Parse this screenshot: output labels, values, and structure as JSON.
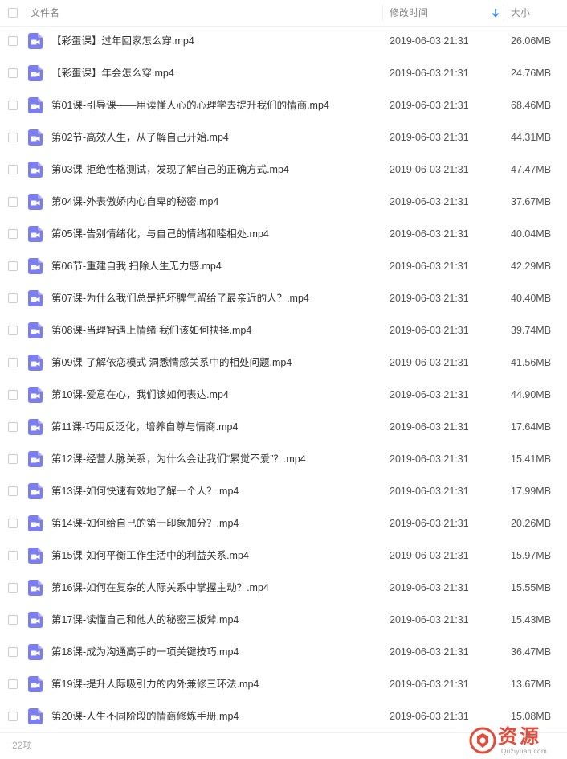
{
  "header": {
    "name_label": "文件名",
    "modified_label": "修改时间",
    "size_label": "大小",
    "sort_arrow": "↓"
  },
  "files": [
    {
      "name": "【彩蛋课】过年回家怎么穿.mp4",
      "modified": "2019-06-03 21:31",
      "size": "26.06MB"
    },
    {
      "name": "【彩蛋课】年会怎么穿.mp4",
      "modified": "2019-06-03 21:31",
      "size": "24.76MB"
    },
    {
      "name": "第01课-引导课——用读懂人心的心理学去提升我们的情商.mp4",
      "modified": "2019-06-03 21:31",
      "size": "68.46MB"
    },
    {
      "name": "第02节-高效人生，从了解自己开始.mp4",
      "modified": "2019-06-03 21:31",
      "size": "44.31MB"
    },
    {
      "name": "第03课-拒绝性格测试，发现了解自己的正确方式.mp4",
      "modified": "2019-06-03 21:31",
      "size": "47.47MB"
    },
    {
      "name": "第04课-外表傲娇内心自卑的秘密.mp4",
      "modified": "2019-06-03 21:31",
      "size": "37.67MB"
    },
    {
      "name": "第05课-告别情绪化，与自己的情绪和睦相处.mp4",
      "modified": "2019-06-03 21:31",
      "size": "40.04MB"
    },
    {
      "name": "第06节-重建自我 扫除人生无力感.mp4",
      "modified": "2019-06-03 21:31",
      "size": "42.29MB"
    },
    {
      "name": "第07课-为什么我们总是把坏脾气留给了最亲近的人？.mp4",
      "modified": "2019-06-03 21:31",
      "size": "40.40MB"
    },
    {
      "name": "第08课-当理智遇上情绪 我们该如何抉择.mp4",
      "modified": "2019-06-03 21:31",
      "size": "39.74MB"
    },
    {
      "name": "第09课-了解依恋模式 洞悉情感关系中的相处问题.mp4",
      "modified": "2019-06-03 21:31",
      "size": "41.56MB"
    },
    {
      "name": "第10课-爱意在心，我们该如何表达.mp4",
      "modified": "2019-06-03 21:31",
      "size": "44.90MB"
    },
    {
      "name": "第11课-巧用反泛化，培养自尊与情商.mp4",
      "modified": "2019-06-03 21:31",
      "size": "17.64MB"
    },
    {
      "name": "第12课-经营人脉关系，为什么会让我们“累觉不爱”？.mp4",
      "modified": "2019-06-03 21:31",
      "size": "15.41MB"
    },
    {
      "name": "第13课-如何快速有效地了解一个人？.mp4",
      "modified": "2019-06-03 21:31",
      "size": "17.99MB"
    },
    {
      "name": "第14课-如何给自己的第一印象加分？.mp4",
      "modified": "2019-06-03 21:31",
      "size": "20.26MB"
    },
    {
      "name": "第15课-如何平衡工作生活中的利益关系.mp4",
      "modified": "2019-06-03 21:31",
      "size": "15.97MB"
    },
    {
      "name": "第16课-如何在复杂的人际关系中掌握主动？.mp4",
      "modified": "2019-06-03 21:31",
      "size": "15.55MB"
    },
    {
      "name": "第17课-读懂自己和他人的秘密三板斧.mp4",
      "modified": "2019-06-03 21:31",
      "size": "15.43MB"
    },
    {
      "name": "第18课-成为沟通高手的一项关键技巧.mp4",
      "modified": "2019-06-03 21:31",
      "size": "36.47MB"
    },
    {
      "name": "第19课-提升人际吸引力的内外兼修三环法.mp4",
      "modified": "2019-06-03 21:31",
      "size": "13.67MB"
    },
    {
      "name": "第20课-人生不同阶段的情商修炼手册.mp4",
      "modified": "2019-06-03 21:31",
      "size": "15.08MB"
    }
  ],
  "footer": {
    "count": "22项"
  },
  "watermark": {
    "text": "资源",
    "url": "Quziyuan.com"
  },
  "colors": {
    "video_icon": "#7b7ef2",
    "sort_arrow": "#3b8cff",
    "watermark": "#e34d3b"
  },
  "icons": {
    "file": "video-file-icon",
    "checkbox": "checkbox",
    "sort": "sort-down-arrow-icon"
  }
}
